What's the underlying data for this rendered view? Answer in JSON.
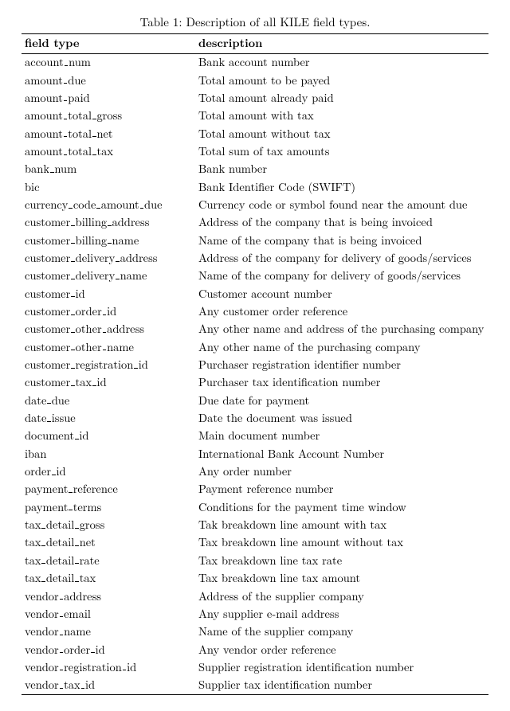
{
  "caption": "Table 1: Description of all KILE field types.",
  "headers": {
    "field_type": "field type",
    "description": "description"
  },
  "rows": [
    {
      "field_parts": [
        "account",
        "num"
      ],
      "desc": "Bank account number"
    },
    {
      "field_parts": [
        "amount",
        "due"
      ],
      "desc": "Total amount to be payed"
    },
    {
      "field_parts": [
        "amount",
        "paid"
      ],
      "desc": "Total amount already paid"
    },
    {
      "field_parts": [
        "amount",
        "total",
        "gross"
      ],
      "desc": "Total amount with tax"
    },
    {
      "field_parts": [
        "amount",
        "total",
        "net"
      ],
      "desc": "Total amount without tax"
    },
    {
      "field_parts": [
        "amount",
        "total",
        "tax"
      ],
      "desc": "Total sum of tax amounts"
    },
    {
      "field_parts": [
        "bank",
        "num"
      ],
      "desc": "Bank number"
    },
    {
      "field_parts": [
        "bic"
      ],
      "desc": "Bank Identifier Code (SWIFT)"
    },
    {
      "field_parts": [
        "currency",
        "code",
        "amount",
        "due"
      ],
      "desc": "Currency code or symbol found near the amount due"
    },
    {
      "field_parts": [
        "customer",
        "billing",
        "address"
      ],
      "desc": "Address of the company that is being invoiced"
    },
    {
      "field_parts": [
        "customer",
        "billing",
        "name"
      ],
      "desc": "Name of the company that is being invoiced"
    },
    {
      "field_parts": [
        "customer",
        "delivery",
        "address"
      ],
      "desc": "Address of the company for delivery of goods/services"
    },
    {
      "field_parts": [
        "customer",
        "delivery",
        "name"
      ],
      "desc": "Name of the company for delivery of goods/services"
    },
    {
      "field_parts": [
        "customer",
        "id"
      ],
      "desc": "Customer account number"
    },
    {
      "field_parts": [
        "customer",
        "order",
        "id"
      ],
      "desc": "Any customer order reference"
    },
    {
      "field_parts": [
        "customer",
        "other",
        "address"
      ],
      "desc": "Any other name and address of the purchasing company"
    },
    {
      "field_parts": [
        "customer",
        "other",
        "name"
      ],
      "desc": "Any other name of the purchasing company"
    },
    {
      "field_parts": [
        "customer",
        "registration",
        "id"
      ],
      "desc": "Purchaser registration identifier number"
    },
    {
      "field_parts": [
        "customer",
        "tax",
        "id"
      ],
      "desc": "Purchaser tax identification number"
    },
    {
      "field_parts": [
        "date",
        "due"
      ],
      "desc": "Due date for payment"
    },
    {
      "field_parts": [
        "date",
        "issue"
      ],
      "desc": "Date the document was issued"
    },
    {
      "field_parts": [
        "document",
        "id"
      ],
      "desc": "Main document number"
    },
    {
      "field_parts": [
        "iban"
      ],
      "desc": "International Bank Account Number"
    },
    {
      "field_parts": [
        "order",
        "id"
      ],
      "desc": "Any order number"
    },
    {
      "field_parts": [
        "payment",
        "reference"
      ],
      "desc": "Payment reference number"
    },
    {
      "field_parts": [
        "payment",
        "terms"
      ],
      "desc": "Conditions for the payment time window"
    },
    {
      "field_parts": [
        "tax",
        "detail",
        "gross"
      ],
      "desc": "Tak breakdown line amount with tax"
    },
    {
      "field_parts": [
        "tax",
        "detail",
        "net"
      ],
      "desc": "Tax breakdown line amount without tax"
    },
    {
      "field_parts": [
        "tax",
        "detail",
        "rate"
      ],
      "desc": "Tax breakdown line tax rate"
    },
    {
      "field_parts": [
        "tax",
        "detail",
        "tax"
      ],
      "desc": "Tax breakdown line tax amount"
    },
    {
      "field_parts": [
        "vendor",
        "address"
      ],
      "desc": "Address of the supplier company"
    },
    {
      "field_parts": [
        "vendor",
        "email"
      ],
      "desc": "Any supplier e-mail address"
    },
    {
      "field_parts": [
        "vendor",
        "name"
      ],
      "desc": "Name of the supplier company"
    },
    {
      "field_parts": [
        "vendor",
        "order",
        "id"
      ],
      "desc": "Any vendor order reference"
    },
    {
      "field_parts": [
        "vendor",
        "registration",
        "id"
      ],
      "desc": "Supplier registration identification number"
    },
    {
      "field_parts": [
        "vendor",
        "tax",
        "id"
      ],
      "desc": "Supplier tax identification number"
    }
  ]
}
